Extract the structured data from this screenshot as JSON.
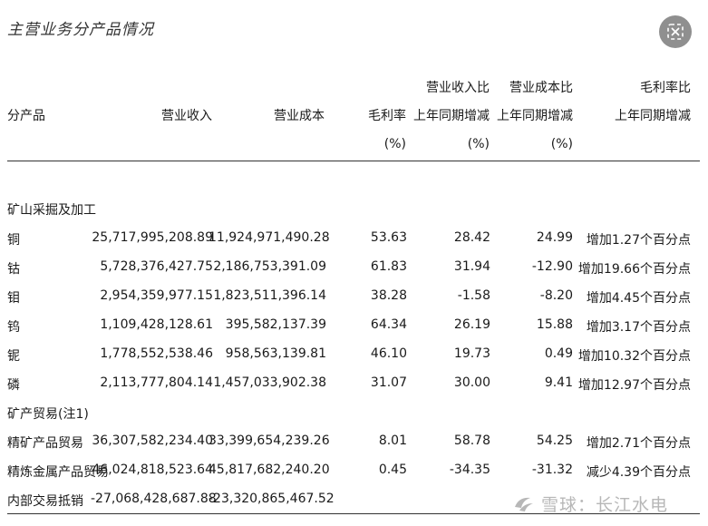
{
  "title": "主营业务分产品情况",
  "headers": {
    "product": "分产品",
    "revenue": "营业收入",
    "cost": "营业成本",
    "margin_l1": "毛利率",
    "margin_l2": "(%)",
    "rev_chg_l1": "营业收入比",
    "rev_chg_l2": "上年同期增减",
    "rev_chg_l3": "(%)",
    "cost_chg_l1": "营业成本比",
    "cost_chg_l2": "上年同期增减",
    "cost_chg_l3": "(%)",
    "margin_chg_l1": "毛利率比",
    "margin_chg_l2": "上年同期增减"
  },
  "rows": [
    {
      "product": "矿山采掘及加工",
      "revenue": "",
      "cost": "",
      "margin": "",
      "rev_chg": "",
      "cost_chg": "",
      "margin_chg": ""
    },
    {
      "product": "铜",
      "revenue": "25,717,995,208.89",
      "cost": "11,924,971,490.28",
      "margin": "53.63",
      "rev_chg": "28.42",
      "cost_chg": "24.99",
      "margin_chg": "增加1.27个百分点"
    },
    {
      "product": "钴",
      "revenue": "5,728,376,427.75",
      "cost": "2,186,753,391.09",
      "margin": "61.83",
      "rev_chg": "31.94",
      "cost_chg": "-12.90",
      "margin_chg": "增加19.66个百分点"
    },
    {
      "product": "钼",
      "revenue": "2,954,359,977.15",
      "cost": "1,823,511,396.14",
      "margin": "38.28",
      "rev_chg": "-1.58",
      "cost_chg": "-8.20",
      "margin_chg": "增加4.45个百分点"
    },
    {
      "product": "钨",
      "revenue": "1,109,428,128.61",
      "cost": "395,582,137.39",
      "margin": "64.34",
      "rev_chg": "26.19",
      "cost_chg": "15.88",
      "margin_chg": "增加3.17个百分点"
    },
    {
      "product": "铌",
      "revenue": "1,778,552,538.46",
      "cost": "958,563,139.81",
      "margin": "46.10",
      "rev_chg": "19.73",
      "cost_chg": "0.49",
      "margin_chg": "增加10.32个百分点"
    },
    {
      "product": "磷",
      "revenue": "2,113,777,804.14",
      "cost": "1,457,033,902.38",
      "margin": "31.07",
      "rev_chg": "30.00",
      "cost_chg": "9.41",
      "margin_chg": "增加12.97个百分点"
    },
    {
      "product": "矿产贸易(注1)",
      "revenue": "",
      "cost": "",
      "margin": "",
      "rev_chg": "",
      "cost_chg": "",
      "margin_chg": ""
    },
    {
      "product": "精矿产品贸易",
      "revenue": "36,307,582,234.40",
      "cost": "33,399,654,239.26",
      "margin": "8.01",
      "rev_chg": "58.78",
      "cost_chg": "54.25",
      "margin_chg": "增加2.71个百分点"
    },
    {
      "product": "精炼金属产品贸易",
      "revenue": "46,024,818,523.64",
      "cost": "45,817,682,240.20",
      "margin": "0.45",
      "rev_chg": "-34.35",
      "cost_chg": "-31.32",
      "margin_chg": "减少4.39个百分点"
    },
    {
      "product": "内部交易抵销",
      "revenue": "-27,068,428,687.88",
      "cost": "-23,320,865,467.52",
      "margin": "",
      "rev_chg": "",
      "cost_chg": "",
      "margin_chg": ""
    }
  ],
  "watermark": "雪球：长江水电",
  "icons": {
    "close": "close-icon",
    "watermark_logo": "snowball-logo-icon"
  }
}
